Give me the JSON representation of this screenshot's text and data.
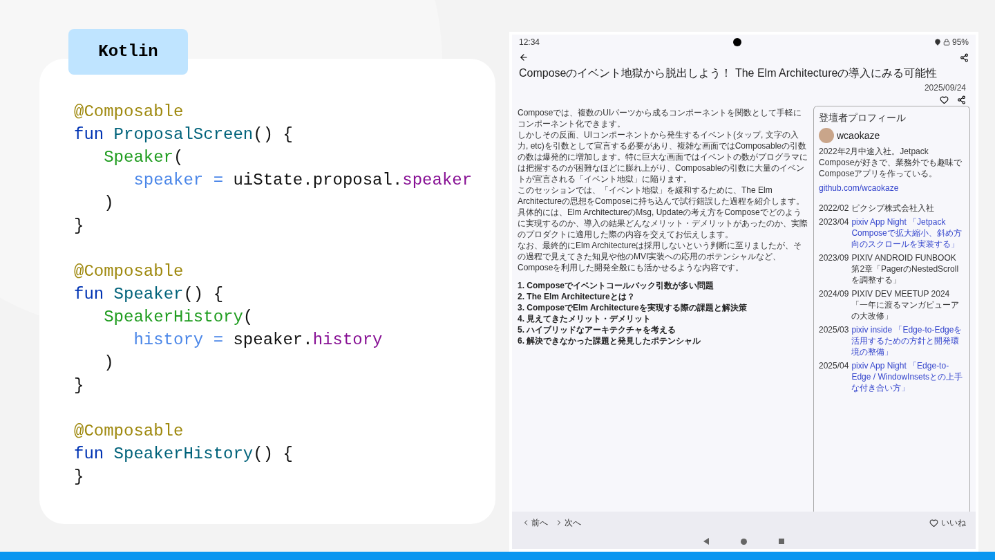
{
  "language_tag": "Kotlin",
  "code_blocks": [
    [
      [
        {
          "kind": "annotation",
          "text": "@Composable"
        }
      ],
      [
        {
          "kind": "keyword",
          "text": "fun"
        },
        {
          "kind": "function",
          "text": " ProposalScreen"
        },
        {
          "kind": "plain",
          "text": "() {"
        }
      ],
      [
        {
          "kind": "call",
          "text": "   Speaker"
        },
        {
          "kind": "plain",
          "text": "("
        }
      ],
      [
        {
          "kind": "param",
          "text": "      speaker ="
        },
        {
          "kind": "plain",
          "text": " uiState.proposal."
        },
        {
          "kind": "property",
          "text": "speaker"
        }
      ],
      [
        {
          "kind": "plain",
          "text": "   )"
        }
      ],
      [
        {
          "kind": "plain",
          "text": "}"
        }
      ]
    ],
    [
      [
        {
          "kind": "annotation",
          "text": "@Composable"
        }
      ],
      [
        {
          "kind": "keyword",
          "text": "fun"
        },
        {
          "kind": "function",
          "text": " Speaker"
        },
        {
          "kind": "plain",
          "text": "() {"
        }
      ],
      [
        {
          "kind": "call",
          "text": "   SpeakerHistory"
        },
        {
          "kind": "plain",
          "text": "("
        }
      ],
      [
        {
          "kind": "param",
          "text": "      history ="
        },
        {
          "kind": "plain",
          "text": " speaker."
        },
        {
          "kind": "property",
          "text": "history"
        }
      ],
      [
        {
          "kind": "plain",
          "text": "   )"
        }
      ],
      [
        {
          "kind": "plain",
          "text": "}"
        }
      ]
    ],
    [
      [
        {
          "kind": "annotation",
          "text": "@Composable"
        }
      ],
      [
        {
          "kind": "keyword",
          "text": "fun"
        },
        {
          "kind": "function",
          "text": " SpeakerHistory"
        },
        {
          "kind": "plain",
          "text": "() {"
        }
      ],
      [
        {
          "kind": "plain",
          "text": "}"
        }
      ]
    ]
  ],
  "phone": {
    "status_bar": {
      "time": "12:34",
      "battery": "95%"
    },
    "title": "Composeのイベント地獄から脱出しよう！ The Elm Architectureの導入にみる可能性",
    "date": "2025/09/24",
    "description": [
      "Composeでは、複数のUIパーツから成るコンポーネントを関数として手軽にコンポーネント化できます。",
      "しかしその反面、UIコンポーネントから発生するイベント(タップ, 文字の入力, etc)を引数として宣言する必要があり、複雑な画面ではComposableの引数の数は爆発的に増加します。特に巨大な画面ではイベントの数がプログラマには把握するのが困難なほどに膨れ上がり、Composableの引数に大量のイベントが宣言される「イベント地獄」に陥ります。",
      "このセッションでは、「イベント地獄」を緩和するために、The Elm Architectureの思想をComposeに持ち込んで試行錯誤した過程を紹介します。",
      "具体的には、Elm ArchitectureのMsg, Updateの考え方をComposeでどのように実現するのか、導入の結果どんなメリット・デメリットがあったのか、実際のプロダクトに適用した際の内容を交えてお伝えします。",
      "なお、最終的にElm Architectureは採用しないという判断に至りましたが、その過程で見えてきた知見や他のMVI実装への応用のポテンシャルなど、Composeを利用した開発全般にも活かせるような内容です。"
    ],
    "agenda": [
      "1. Composeでイベントコールバック引数が多い問題",
      "2. The Elm Architectureとは？",
      "3. ComposeでElm Architectureを実現する際の課題と解決策",
      "4. 見えてきたメリット・デメリット",
      "5. ハイブリッドなアーキテクチャを考える",
      "6. 解決できなかった課題と発見したポテンシャル"
    ],
    "profile": {
      "heading": "登壇者プロフィール",
      "name": "wcaokaze",
      "bio": "2022年2月中途入社。Jetpack Composeが好きで、業務外でも趣味でComposeアプリを作っている。",
      "link": "github.com/wcaokaze",
      "history": [
        {
          "date": "2022/02",
          "text": "ピクシブ株式会社入社",
          "link": false
        },
        {
          "date": "2023/04",
          "text": "pixiv App Night 「Jetpack Composeで拡大縮小、斜め方向のスクロールを実装する」",
          "link": true
        },
        {
          "date": "2023/09",
          "text": "PIXIV ANDROID FUNBOOK 第2章「PagerのNestedScrollを調整する」",
          "link": false
        },
        {
          "date": "2024/09",
          "text": "PIXIV DEV MEETUP 2024 「一年に渡るマンガビューアの大改修」",
          "link": false
        },
        {
          "date": "2025/03",
          "text": "pixiv inside 「Edge-to-Edgeを活用するための方針と開発環境の整備」",
          "link": true
        },
        {
          "date": "2025/04",
          "text": "pixiv App Night 「Edge-to-Edge / WindowInsetsとの上手な付き合い方」",
          "link": true
        }
      ]
    },
    "bottom_bar": {
      "prev": "前へ",
      "next": "次へ",
      "like": "いいね"
    }
  }
}
